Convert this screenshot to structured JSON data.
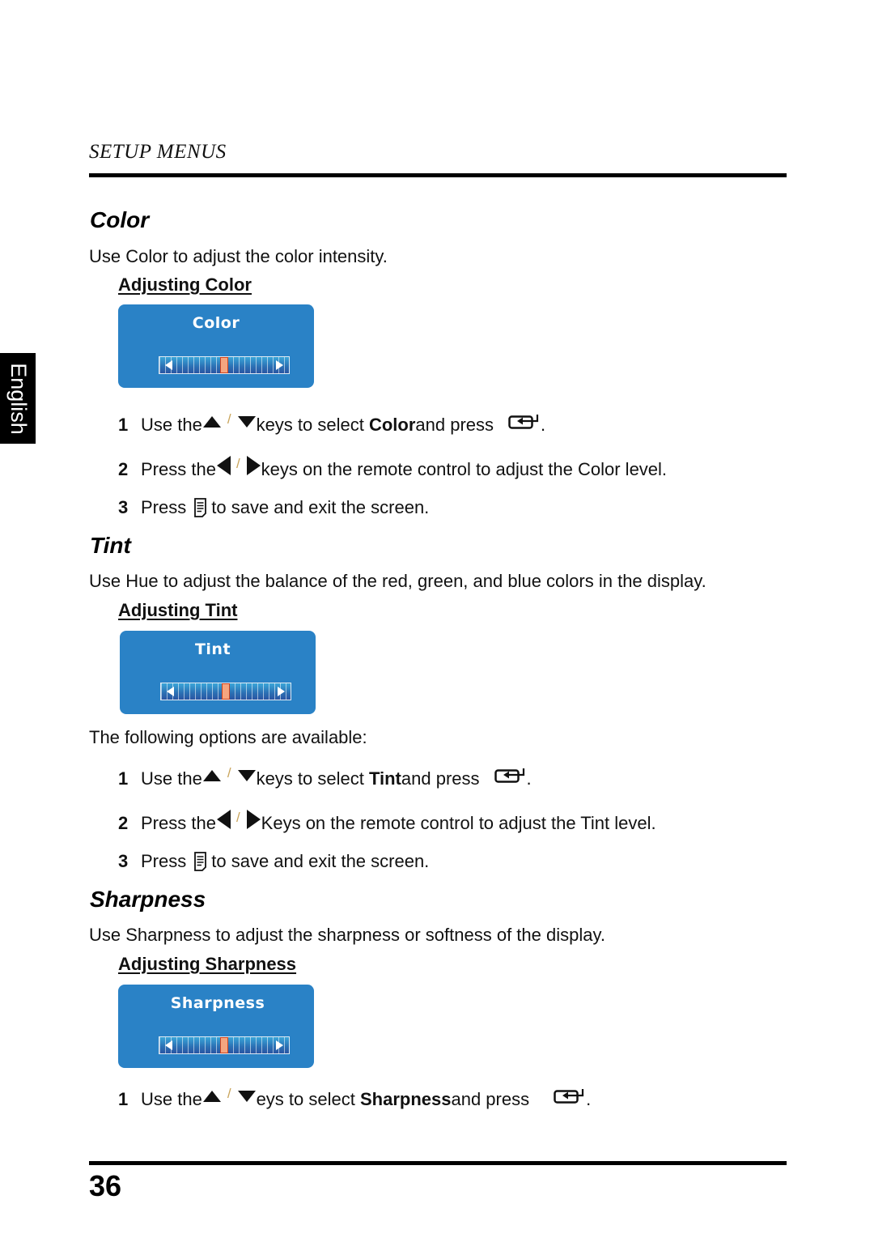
{
  "header": {
    "title": "SETUP MENUS"
  },
  "language_tab": {
    "label": "English"
  },
  "footer": {
    "page_number": "36"
  },
  "icons": {
    "up": "up-arrow-icon",
    "down": "down-arrow-icon",
    "left": "left-arrow-icon",
    "right": "right-arrow-icon",
    "enter": "enter-icon",
    "menu": "menu-icon",
    "separator": "/"
  },
  "sections": {
    "color": {
      "title": "Color",
      "description": "Use Color to adjust the color intensity.",
      "subtitle": "Adjusting Color",
      "osd": {
        "title": "Color",
        "level_percent": 50
      },
      "steps": [
        {
          "num": "1",
          "pre": "Use the",
          "mid": "keys to select ",
          "bold": "Color",
          "post": " and press",
          "end": "."
        },
        {
          "num": "2",
          "pre": "Press the",
          "mid": "keys on the remote control to adjust the Color level."
        },
        {
          "num": "3",
          "pre": "Press",
          "post": "to save and exit the screen."
        }
      ]
    },
    "tint": {
      "title": "Tint",
      "description": "Use Hue to adjust the balance of the red, green, and blue colors in the display.",
      "subtitle": "Adjusting Tint",
      "osd": {
        "title": "Tint",
        "level_percent": 50
      },
      "options_intro": "The following options are available:",
      "steps": [
        {
          "num": "1",
          "pre": "Use the",
          "mid": "keys to select ",
          "bold": "Tint",
          "post": " and press",
          "end": "."
        },
        {
          "num": "2",
          "pre": "Press the",
          "mid": "Keys on the remote control to adjust the Tint level."
        },
        {
          "num": "3",
          "pre": "Press",
          "post": "to save and exit the screen."
        }
      ]
    },
    "sharpness": {
      "title": "Sharpness",
      "description": "Use Sharpness to adjust the sharpness or softness of the display.",
      "subtitle": "Adjusting Sharpness",
      "osd": {
        "title": "Sharpness",
        "level_percent": 50
      },
      "steps": [
        {
          "num": "1",
          "pre": "Use the",
          "mid": "eys to select ",
          "bold": "Sharpness",
          "post": " and press",
          "end": "."
        }
      ]
    }
  },
  "colors": {
    "osd_background": "#2a82c6",
    "slider_thumb": "#f5a57f",
    "slider_thumb_border": "#d0451e"
  }
}
